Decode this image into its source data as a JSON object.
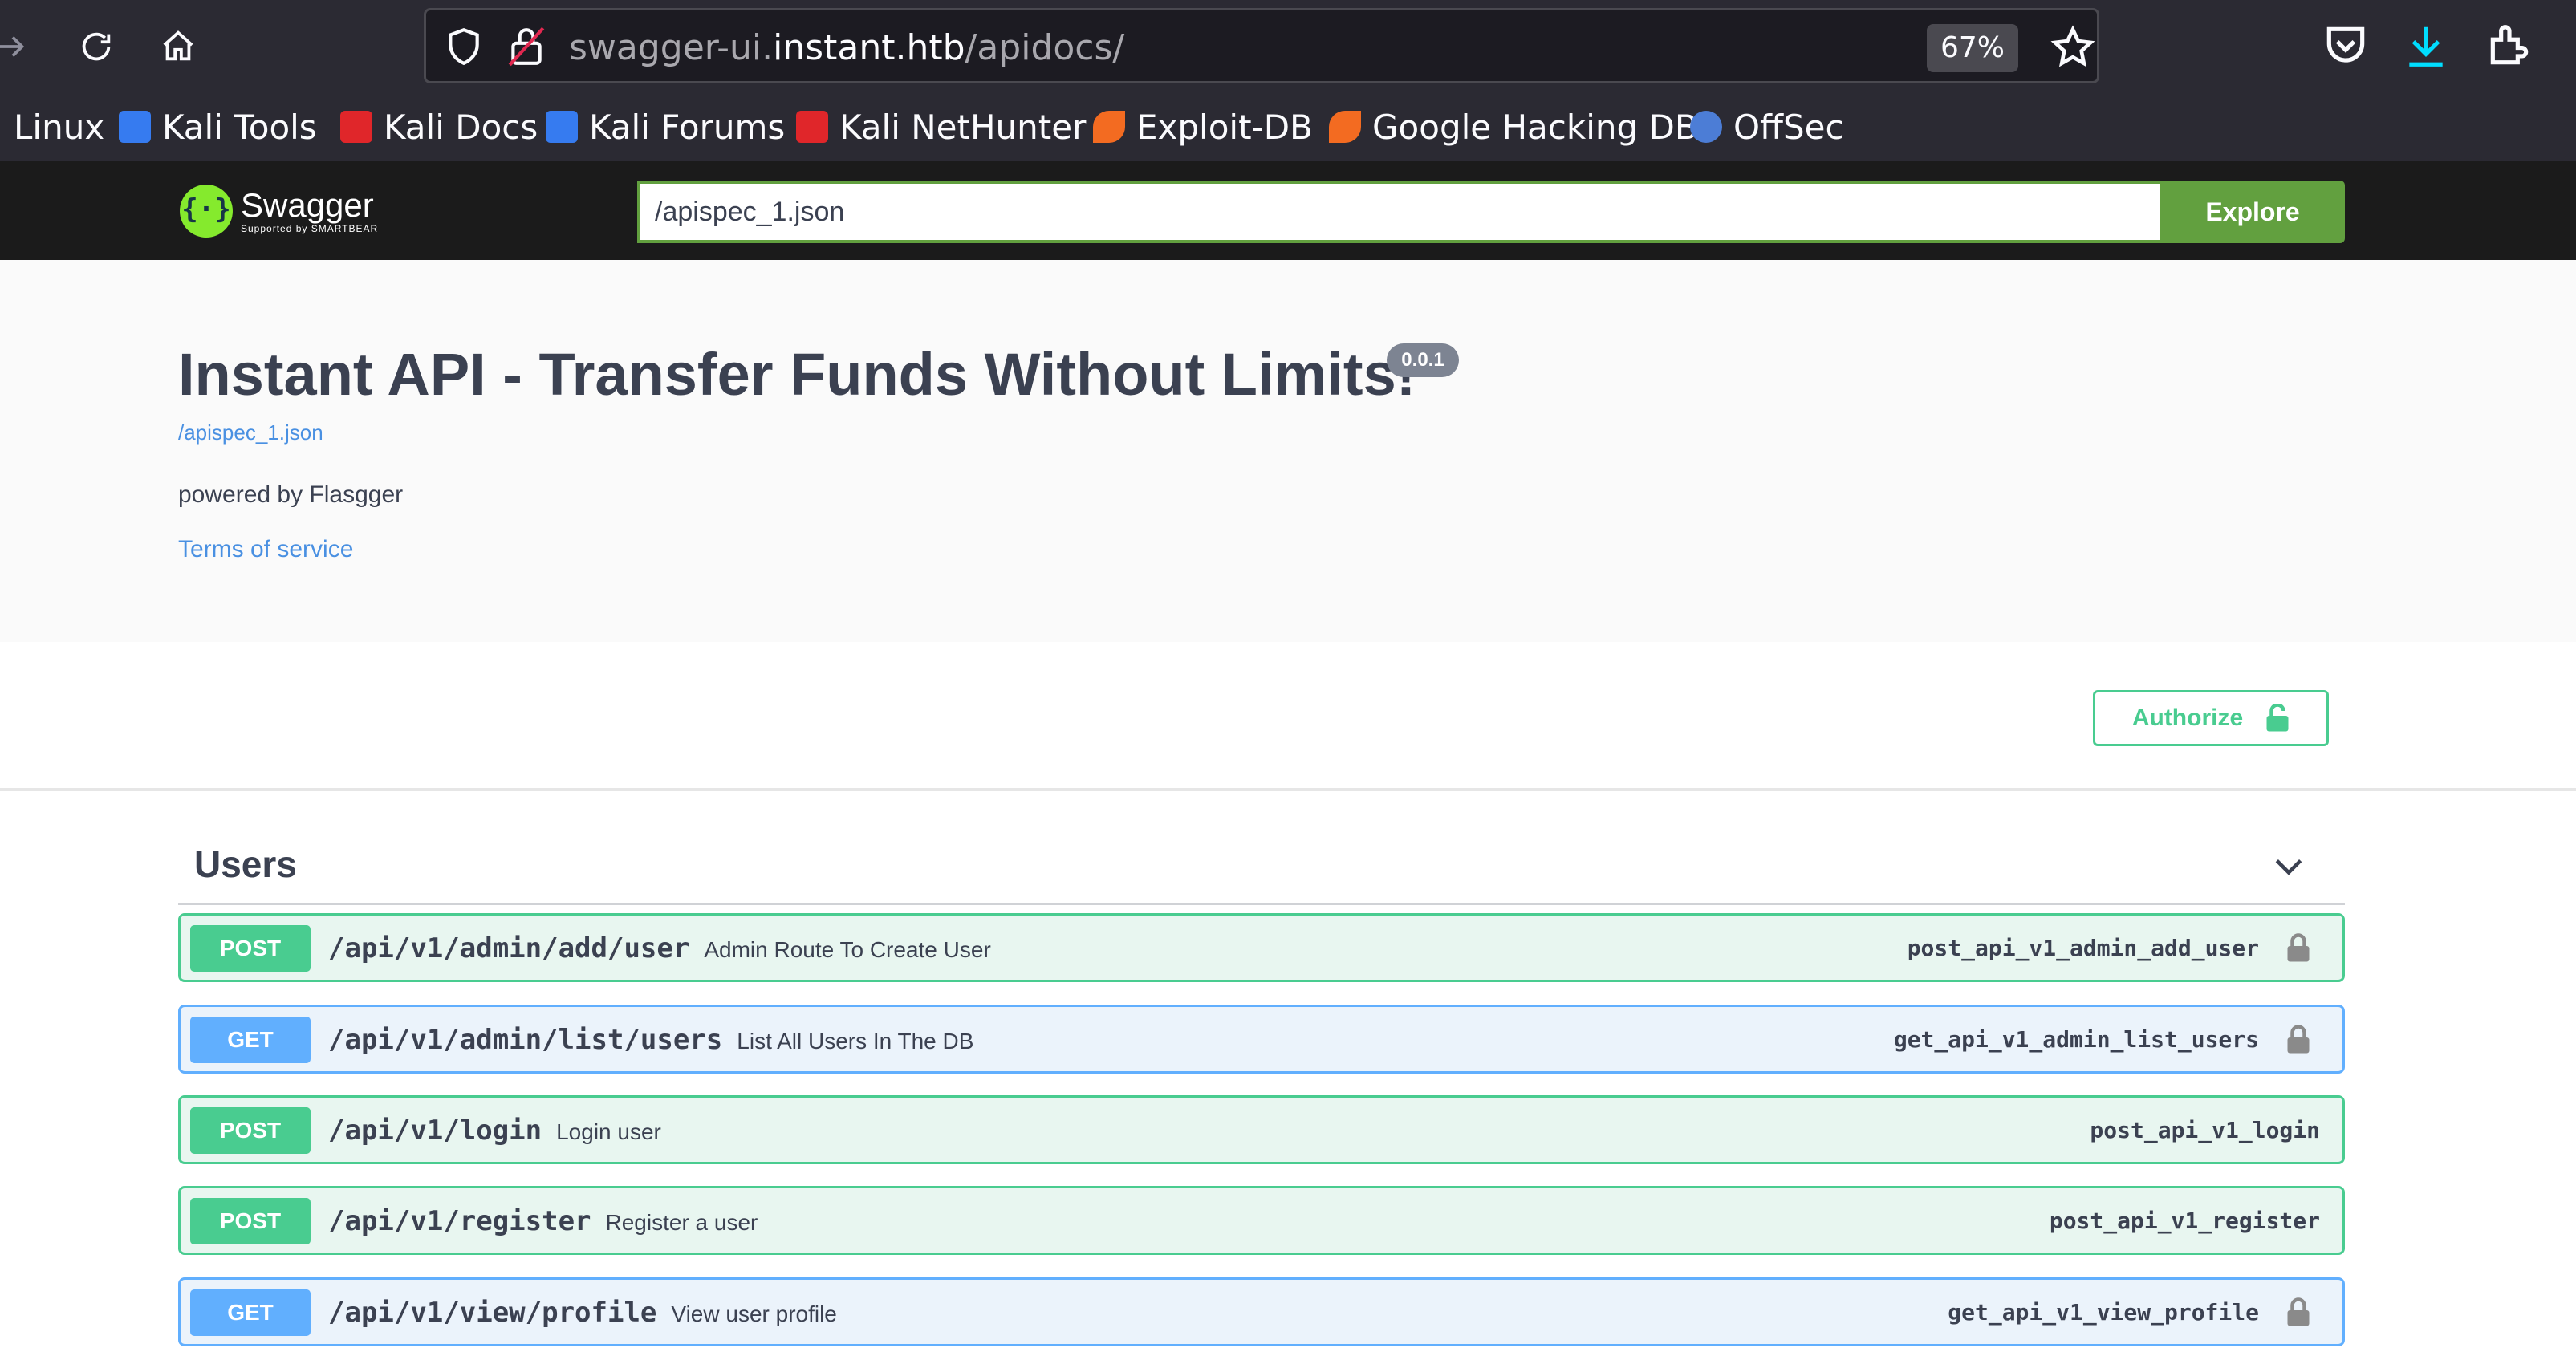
{
  "browser": {
    "url_prefix": "swagger-ui.",
    "url_host": "instant.htb",
    "url_path": "/apidocs/",
    "zoom": "67%",
    "bookmarks": [
      {
        "label": "i Linux",
        "icon": "kali-linux-icon"
      },
      {
        "label": "Kali Tools",
        "icon": "kali-tools-icon",
        "color": "#367bf0"
      },
      {
        "label": "Kali Docs",
        "icon": "kali-docs-icon",
        "color": "#e0262a"
      },
      {
        "label": "Kali Forums",
        "icon": "kali-forums-icon",
        "color": "#367bf0"
      },
      {
        "label": "Kali NetHunter",
        "icon": "kali-nethunter-icon",
        "color": "#e0262a"
      },
      {
        "label": "Exploit-DB",
        "icon": "exploit-db-icon",
        "color": "#f36b21"
      },
      {
        "label": "Google Hacking DB",
        "icon": "google-hacking-db-icon",
        "color": "#f36b21"
      },
      {
        "label": "OffSec",
        "icon": "offsec-icon",
        "color": "#4c7dd6"
      }
    ]
  },
  "swagger": {
    "logo_title": "Swagger",
    "logo_subtitle": "Supported by SMARTBEAR",
    "spec_input_value": "/apispec_1.json",
    "explore_label": "Explore"
  },
  "info": {
    "title": "Instant API - Transfer Funds Without Limits!",
    "version": "0.0.1",
    "spec_link": "/apispec_1.json",
    "powered_by": "powered by Flasgger",
    "terms_of_service": "Terms of service"
  },
  "authorize": {
    "label": "Authorize"
  },
  "tags": [
    {
      "name": "Users",
      "operations": [
        {
          "method": "POST",
          "path": "/api/v1/admin/add/user",
          "summary": "Admin Route To Create User",
          "operation_id": "post_api_v1_admin_add_user",
          "locked": true
        },
        {
          "method": "GET",
          "path": "/api/v1/admin/list/users",
          "summary": "List All Users In The DB",
          "operation_id": "get_api_v1_admin_list_users",
          "locked": true
        },
        {
          "method": "POST",
          "path": "/api/v1/login",
          "summary": "Login user",
          "operation_id": "post_api_v1_login",
          "locked": false
        },
        {
          "method": "POST",
          "path": "/api/v1/register",
          "summary": "Register a user",
          "operation_id": "post_api_v1_register",
          "locked": false
        },
        {
          "method": "GET",
          "path": "/api/v1/view/profile",
          "summary": "View user profile",
          "operation_id": "get_api_v1_view_profile",
          "locked": true
        }
      ]
    }
  ],
  "colors": {
    "post": "#49cc90",
    "get": "#61affe",
    "explore": "#62a03f",
    "swagger_logo": "#85ea2d"
  }
}
